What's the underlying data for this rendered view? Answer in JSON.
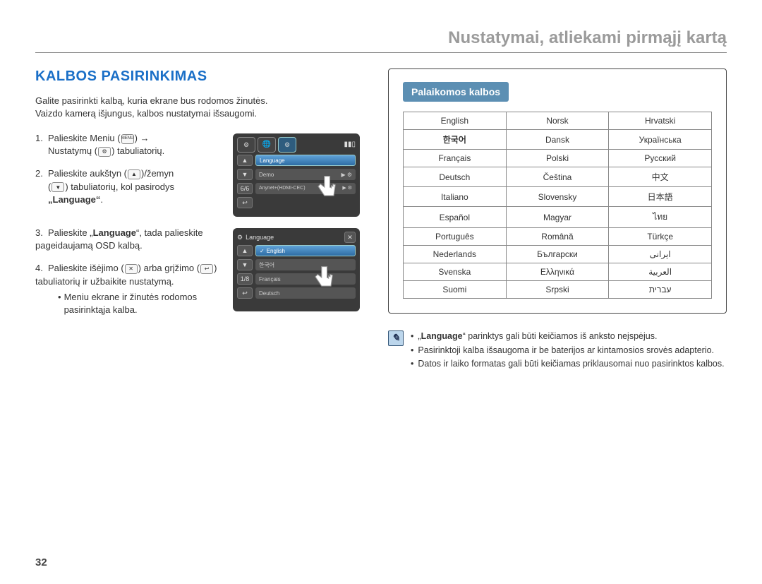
{
  "header": {
    "title": "Nustatymai, atliekami pirmąjį kartą"
  },
  "section": {
    "heading": "KALBOS PASIRINKIMAS"
  },
  "intro": {
    "line1": "Galite pasirinkti kalbą, kuria ekrane bus rodomos žinutės.",
    "line2": "Vaizdo kamerą išjungus, kalbos nustatymai išsaugomi."
  },
  "steps": {
    "s1a": "Palieskite Meniu (",
    "s1b": ") →",
    "s1c": "Nustatymų (",
    "s1d": ") tabuliatorių.",
    "s2a": "Palieskite aukštyn (",
    "s2b": ")/žemyn",
    "s2c": "(",
    "s2d": ") tabuliatorių, kol pasirodys",
    "s2e": "„Language“",
    "s2f": ".",
    "s3a": "Palieskite „",
    "s3b": "Language",
    "s3c": "“, tada palieskite pageidaujamą OSD kalbą.",
    "s4a": "Palieskite išėjimo (",
    "s4b": ") arba grįžimo (",
    "s4c": ") tabuliatorių ir užbaikite nustatymą.",
    "s4sub": "Meniu ekrane ir žinutės rodomos pasirinktąja kalba."
  },
  "icons": {
    "menu": "MENU",
    "gear": "⚙",
    "up": "▲",
    "down": "▼",
    "close": "✕",
    "back": "↩"
  },
  "lcd1": {
    "row1": "Language",
    "row2": "Demo",
    "row3": "Anynet+(HDMI-CEC)",
    "counter": "6/6"
  },
  "lcd2": {
    "title": "Language",
    "r1": "English",
    "r2": "한국어",
    "r3": "Français",
    "r4": "Deutsch",
    "counter": "1/8",
    "check": "✓"
  },
  "supported": {
    "tab": "Palaikomos kalbos",
    "rows": [
      [
        "English",
        "Norsk",
        "Hrvatski"
      ],
      [
        "한국어",
        "Dansk",
        "Українська"
      ],
      [
        "Français",
        "Polski",
        "Русский"
      ],
      [
        "Deutsch",
        "Čeština",
        "中文"
      ],
      [
        "Italiano",
        "Slovensky",
        "日本語"
      ],
      [
        "Español",
        "Magyar",
        "ไทย"
      ],
      [
        "Português",
        "Română",
        "Türkçe"
      ],
      [
        "Nederlands",
        "Български",
        "ایرانی"
      ],
      [
        "Svenska",
        "Ελληνικά",
        "العربية"
      ],
      [
        "Suomi",
        "Srpski",
        "עברית"
      ]
    ]
  },
  "notes": {
    "n1a": "„",
    "n1b": "Language",
    "n1c": "“ parinktys gali būti keičiamos iš anksto neįspėjus.",
    "n2": "Pasirinktoji kalba išsaugoma ir be baterijos ar kintamosios srovės adapterio.",
    "n3": "Datos ir laiko formatas gali būti keičiamas priklausomai nuo pasirinktos kalbos."
  },
  "page": "32"
}
